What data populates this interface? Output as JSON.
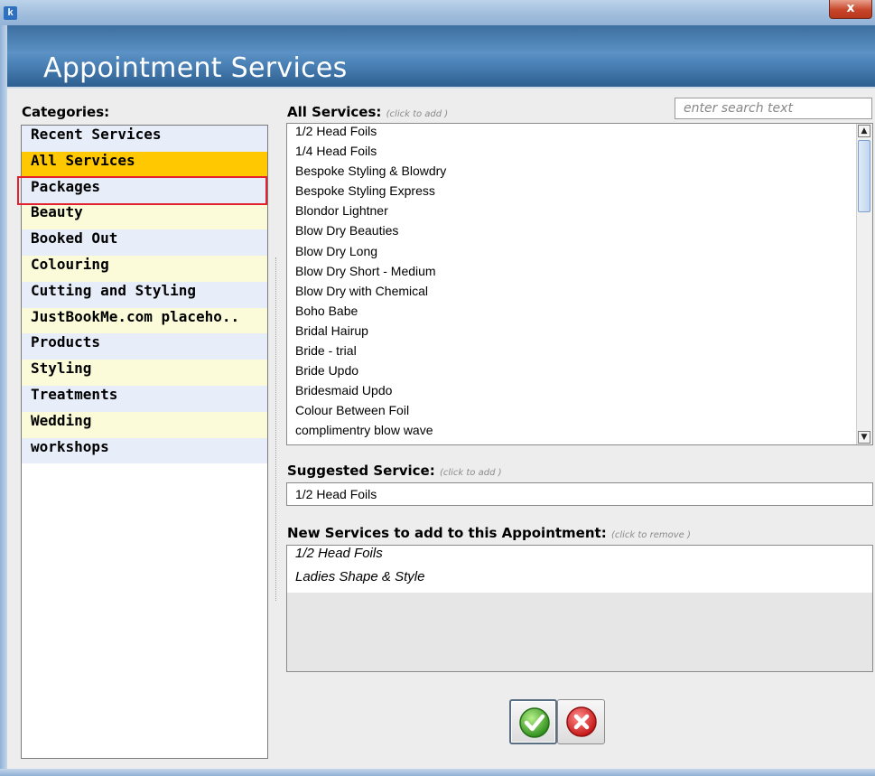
{
  "window": {
    "app_icon_letter": "k",
    "close_glyph": "x",
    "title": "Appointment Services"
  },
  "categories": {
    "label": "Categories:",
    "items": [
      {
        "label": "Recent Services",
        "state": "normal"
      },
      {
        "label": "All Services",
        "state": "selected"
      },
      {
        "label": "Packages",
        "state": "highlighted"
      },
      {
        "label": "Beauty",
        "state": "normal"
      },
      {
        "label": "Booked Out",
        "state": "normal"
      },
      {
        "label": "Colouring",
        "state": "normal"
      },
      {
        "label": "Cutting and Styling",
        "state": "normal"
      },
      {
        "label": "JustBookMe.com placeho..",
        "state": "normal"
      },
      {
        "label": "Products",
        "state": "normal"
      },
      {
        "label": "Styling",
        "state": "normal"
      },
      {
        "label": "Treatments",
        "state": "normal"
      },
      {
        "label": "Wedding",
        "state": "normal"
      },
      {
        "label": "workshops",
        "state": "normal"
      }
    ]
  },
  "all_services": {
    "label": "All Services:",
    "hint": "(click to add )",
    "search_placeholder": "enter search text",
    "items": [
      "1/2 Head Foils",
      "1/4 Head Foils",
      "Bespoke Styling & Blowdry",
      "Bespoke Styling Express",
      "Blondor Lightner",
      "Blow Dry Beauties",
      "Blow Dry Long",
      "Blow Dry Short - Medium",
      "Blow Dry with Chemical",
      "Boho Babe",
      "Bridal Hairup",
      "Bride - trial",
      "Bride Updo",
      "Bridesmaid Updo",
      "Colour Between Foil",
      "complimentry blow wave"
    ],
    "scroll_up_glyph": "▲",
    "scroll_down_glyph": "▼"
  },
  "suggested": {
    "label": "Suggested Service:",
    "hint": "(click to add )",
    "value": "1/2 Head Foils"
  },
  "new_services": {
    "label": "New Services to add to this Appointment:",
    "hint": "(click to remove )",
    "items": [
      "1/2 Head Foils",
      "Ladies Shape & Style"
    ]
  },
  "buttons": {
    "ok_icon": "green-checkmark-icon",
    "cancel_icon": "red-x-icon"
  },
  "colors": {
    "selected_category": "#ffc800",
    "highlight_border": "#e2222f",
    "header_blue": "#4d84b9"
  }
}
